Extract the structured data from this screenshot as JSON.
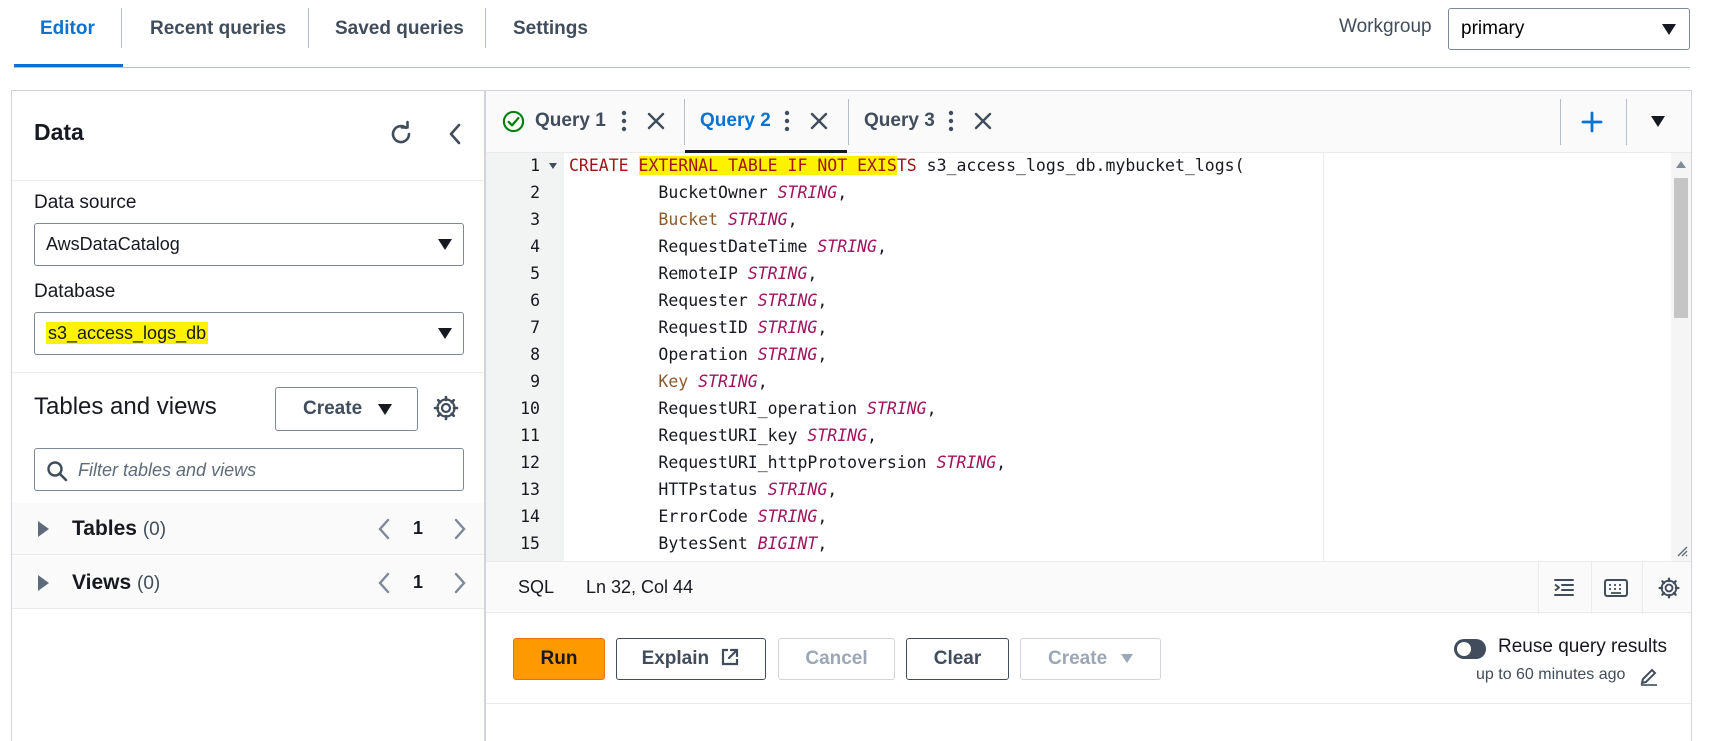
{
  "top_tabs": [
    "Editor",
    "Recent queries",
    "Saved queries",
    "Settings"
  ],
  "workgroup": {
    "label": "Workgroup",
    "value": "primary"
  },
  "data_panel": {
    "title": "Data",
    "data_source_label": "Data source",
    "data_source_value": "AwsDataCatalog",
    "database_label": "Database",
    "database_value": "s3_access_logs_db",
    "tables_views_title": "Tables and views",
    "create_label": "Create",
    "filter_placeholder": "Filter tables and views",
    "tables": {
      "label": "Tables",
      "count": "(0)",
      "page": "1"
    },
    "views": {
      "label": "Views",
      "count": "(0)",
      "page": "1"
    }
  },
  "query_tabs": [
    {
      "label": "Query 1",
      "status": "success"
    },
    {
      "label": "Query 2",
      "status": "active"
    },
    {
      "label": "Query 3",
      "status": ""
    }
  ],
  "code_lines": [
    {
      "n": "1",
      "parts": [
        [
          "kw",
          "CREATE "
        ],
        [
          "kw hlk",
          "EXTERNAL TABLE IF NOT EXIS"
        ],
        [
          "kw",
          "TS "
        ],
        [
          "nm",
          "s3_access_logs_db.mybucket_logs("
        ]
      ]
    },
    {
      "n": "2",
      "parts": [
        [
          "nm",
          "         BucketOwner "
        ],
        [
          "ty",
          "STRING"
        ],
        [
          "nm",
          ","
        ]
      ]
    },
    {
      "n": "3",
      "parts": [
        [
          "nm-kw",
          "         Bucket "
        ],
        [
          "ty",
          "STRING"
        ],
        [
          "nm",
          ","
        ]
      ]
    },
    {
      "n": "4",
      "parts": [
        [
          "nm",
          "         RequestDateTime "
        ],
        [
          "ty",
          "STRING"
        ],
        [
          "nm",
          ","
        ]
      ]
    },
    {
      "n": "5",
      "parts": [
        [
          "nm",
          "         RemoteIP "
        ],
        [
          "ty",
          "STRING"
        ],
        [
          "nm",
          ","
        ]
      ]
    },
    {
      "n": "6",
      "parts": [
        [
          "nm",
          "         Requester "
        ],
        [
          "ty",
          "STRING"
        ],
        [
          "nm",
          ","
        ]
      ]
    },
    {
      "n": "7",
      "parts": [
        [
          "nm",
          "         RequestID "
        ],
        [
          "ty",
          "STRING"
        ],
        [
          "nm",
          ","
        ]
      ]
    },
    {
      "n": "8",
      "parts": [
        [
          "nm",
          "         Operation "
        ],
        [
          "ty",
          "STRING"
        ],
        [
          "nm",
          ","
        ]
      ]
    },
    {
      "n": "9",
      "parts": [
        [
          "nm-kw",
          "         Key "
        ],
        [
          "ty",
          "STRING"
        ],
        [
          "nm",
          ","
        ]
      ]
    },
    {
      "n": "10",
      "parts": [
        [
          "nm",
          "         RequestURI_operation "
        ],
        [
          "ty",
          "STRING"
        ],
        [
          "nm",
          ","
        ]
      ]
    },
    {
      "n": "11",
      "parts": [
        [
          "nm",
          "         RequestURI_key "
        ],
        [
          "ty",
          "STRING"
        ],
        [
          "nm",
          ","
        ]
      ]
    },
    {
      "n": "12",
      "parts": [
        [
          "nm",
          "         RequestURI_httpProtoversion "
        ],
        [
          "ty",
          "STRING"
        ],
        [
          "nm",
          ","
        ]
      ]
    },
    {
      "n": "13",
      "parts": [
        [
          "nm",
          "         HTTPstatus "
        ],
        [
          "ty",
          "STRING"
        ],
        [
          "nm",
          ","
        ]
      ]
    },
    {
      "n": "14",
      "parts": [
        [
          "nm",
          "         ErrorCode "
        ],
        [
          "ty",
          "STRING"
        ],
        [
          "nm",
          ","
        ]
      ]
    },
    {
      "n": "15",
      "parts": [
        [
          "nm",
          "         BytesSent "
        ],
        [
          "ty",
          "BIGINT"
        ],
        [
          "nm",
          ","
        ]
      ]
    }
  ],
  "status_bar": {
    "language": "SQL",
    "cursor": "Ln 32, Col 44"
  },
  "actions": {
    "run": "Run",
    "explain": "Explain",
    "cancel": "Cancel",
    "clear": "Clear",
    "create": "Create",
    "reuse_label": "Reuse query results",
    "reuse_sub": "up to 60 minutes ago"
  },
  "colors": {
    "accent": "#0972d3",
    "run": "#ff9900",
    "highlight": "#fff200"
  }
}
